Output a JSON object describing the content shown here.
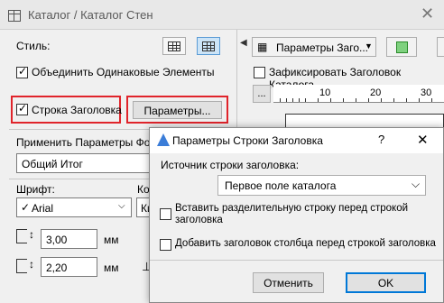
{
  "window": {
    "title": "Каталог / Каталог Стен",
    "close": "✕"
  },
  "left": {
    "style_label": "Стиль:",
    "merge_label": "Объединить Одинаковые Элементы",
    "merge_checked": true,
    "header_row_label": "Строка Заголовка",
    "header_row_checked": true,
    "params_button": "Параметры...",
    "apply_label": "Применить Параметры Фор",
    "format_value": "Общий Итог",
    "font_label": "Шрифт:",
    "code_label": "Ко",
    "font_value": "Arial",
    "code_value": "Ки",
    "size1": "3,00",
    "size2": "2,20",
    "unit": "мм"
  },
  "right": {
    "params_dropdown": "Параметры Заго...",
    "fix_label": "Зафиксировать Заголовок Каталога",
    "fix_checked": false,
    "ellipsis": "...",
    "ruler": [
      "10",
      "20",
      "30"
    ]
  },
  "dialog": {
    "title": "Параметры Строки Заголовка",
    "help": "?",
    "close": "✕",
    "source_label": "Источник строки заголовка:",
    "source_value": "Первое поле каталога",
    "insert_separator": "Вставить разделительную строку перед строкой заголовка",
    "add_column_header": "Добавить заголовок столбца перед строкой заголовка",
    "cancel": "Отменить",
    "ok": "OK"
  }
}
